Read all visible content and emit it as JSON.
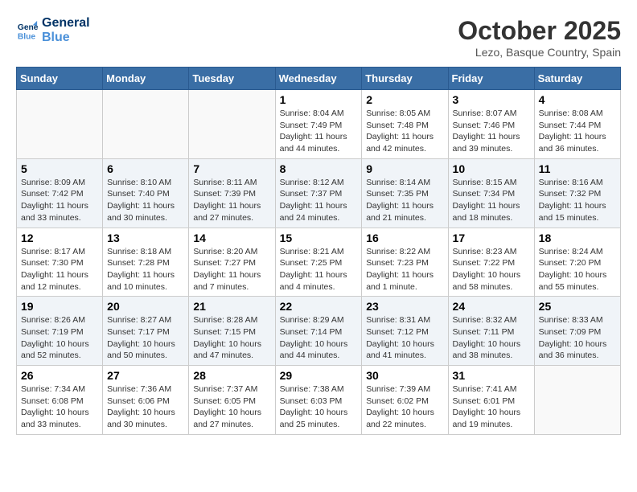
{
  "logo": {
    "line1": "General",
    "line2": "Blue"
  },
  "title": "October 2025",
  "subtitle": "Lezo, Basque Country, Spain",
  "weekdays": [
    "Sunday",
    "Monday",
    "Tuesday",
    "Wednesday",
    "Thursday",
    "Friday",
    "Saturday"
  ],
  "weeks": [
    [
      {
        "day": "",
        "content": ""
      },
      {
        "day": "",
        "content": ""
      },
      {
        "day": "",
        "content": ""
      },
      {
        "day": "1",
        "content": "Sunrise: 8:04 AM\nSunset: 7:49 PM\nDaylight: 11 hours\nand 44 minutes."
      },
      {
        "day": "2",
        "content": "Sunrise: 8:05 AM\nSunset: 7:48 PM\nDaylight: 11 hours\nand 42 minutes."
      },
      {
        "day": "3",
        "content": "Sunrise: 8:07 AM\nSunset: 7:46 PM\nDaylight: 11 hours\nand 39 minutes."
      },
      {
        "day": "4",
        "content": "Sunrise: 8:08 AM\nSunset: 7:44 PM\nDaylight: 11 hours\nand 36 minutes."
      }
    ],
    [
      {
        "day": "5",
        "content": "Sunrise: 8:09 AM\nSunset: 7:42 PM\nDaylight: 11 hours\nand 33 minutes."
      },
      {
        "day": "6",
        "content": "Sunrise: 8:10 AM\nSunset: 7:40 PM\nDaylight: 11 hours\nand 30 minutes."
      },
      {
        "day": "7",
        "content": "Sunrise: 8:11 AM\nSunset: 7:39 PM\nDaylight: 11 hours\nand 27 minutes."
      },
      {
        "day": "8",
        "content": "Sunrise: 8:12 AM\nSunset: 7:37 PM\nDaylight: 11 hours\nand 24 minutes."
      },
      {
        "day": "9",
        "content": "Sunrise: 8:14 AM\nSunset: 7:35 PM\nDaylight: 11 hours\nand 21 minutes."
      },
      {
        "day": "10",
        "content": "Sunrise: 8:15 AM\nSunset: 7:34 PM\nDaylight: 11 hours\nand 18 minutes."
      },
      {
        "day": "11",
        "content": "Sunrise: 8:16 AM\nSunset: 7:32 PM\nDaylight: 11 hours\nand 15 minutes."
      }
    ],
    [
      {
        "day": "12",
        "content": "Sunrise: 8:17 AM\nSunset: 7:30 PM\nDaylight: 11 hours\nand 12 minutes."
      },
      {
        "day": "13",
        "content": "Sunrise: 8:18 AM\nSunset: 7:28 PM\nDaylight: 11 hours\nand 10 minutes."
      },
      {
        "day": "14",
        "content": "Sunrise: 8:20 AM\nSunset: 7:27 PM\nDaylight: 11 hours\nand 7 minutes."
      },
      {
        "day": "15",
        "content": "Sunrise: 8:21 AM\nSunset: 7:25 PM\nDaylight: 11 hours\nand 4 minutes."
      },
      {
        "day": "16",
        "content": "Sunrise: 8:22 AM\nSunset: 7:23 PM\nDaylight: 11 hours\nand 1 minute."
      },
      {
        "day": "17",
        "content": "Sunrise: 8:23 AM\nSunset: 7:22 PM\nDaylight: 10 hours\nand 58 minutes."
      },
      {
        "day": "18",
        "content": "Sunrise: 8:24 AM\nSunset: 7:20 PM\nDaylight: 10 hours\nand 55 minutes."
      }
    ],
    [
      {
        "day": "19",
        "content": "Sunrise: 8:26 AM\nSunset: 7:19 PM\nDaylight: 10 hours\nand 52 minutes."
      },
      {
        "day": "20",
        "content": "Sunrise: 8:27 AM\nSunset: 7:17 PM\nDaylight: 10 hours\nand 50 minutes."
      },
      {
        "day": "21",
        "content": "Sunrise: 8:28 AM\nSunset: 7:15 PM\nDaylight: 10 hours\nand 47 minutes."
      },
      {
        "day": "22",
        "content": "Sunrise: 8:29 AM\nSunset: 7:14 PM\nDaylight: 10 hours\nand 44 minutes."
      },
      {
        "day": "23",
        "content": "Sunrise: 8:31 AM\nSunset: 7:12 PM\nDaylight: 10 hours\nand 41 minutes."
      },
      {
        "day": "24",
        "content": "Sunrise: 8:32 AM\nSunset: 7:11 PM\nDaylight: 10 hours\nand 38 minutes."
      },
      {
        "day": "25",
        "content": "Sunrise: 8:33 AM\nSunset: 7:09 PM\nDaylight: 10 hours\nand 36 minutes."
      }
    ],
    [
      {
        "day": "26",
        "content": "Sunrise: 7:34 AM\nSunset: 6:08 PM\nDaylight: 10 hours\nand 33 minutes."
      },
      {
        "day": "27",
        "content": "Sunrise: 7:36 AM\nSunset: 6:06 PM\nDaylight: 10 hours\nand 30 minutes."
      },
      {
        "day": "28",
        "content": "Sunrise: 7:37 AM\nSunset: 6:05 PM\nDaylight: 10 hours\nand 27 minutes."
      },
      {
        "day": "29",
        "content": "Sunrise: 7:38 AM\nSunset: 6:03 PM\nDaylight: 10 hours\nand 25 minutes."
      },
      {
        "day": "30",
        "content": "Sunrise: 7:39 AM\nSunset: 6:02 PM\nDaylight: 10 hours\nand 22 minutes."
      },
      {
        "day": "31",
        "content": "Sunrise: 7:41 AM\nSunset: 6:01 PM\nDaylight: 10 hours\nand 19 minutes."
      },
      {
        "day": "",
        "content": ""
      }
    ]
  ]
}
